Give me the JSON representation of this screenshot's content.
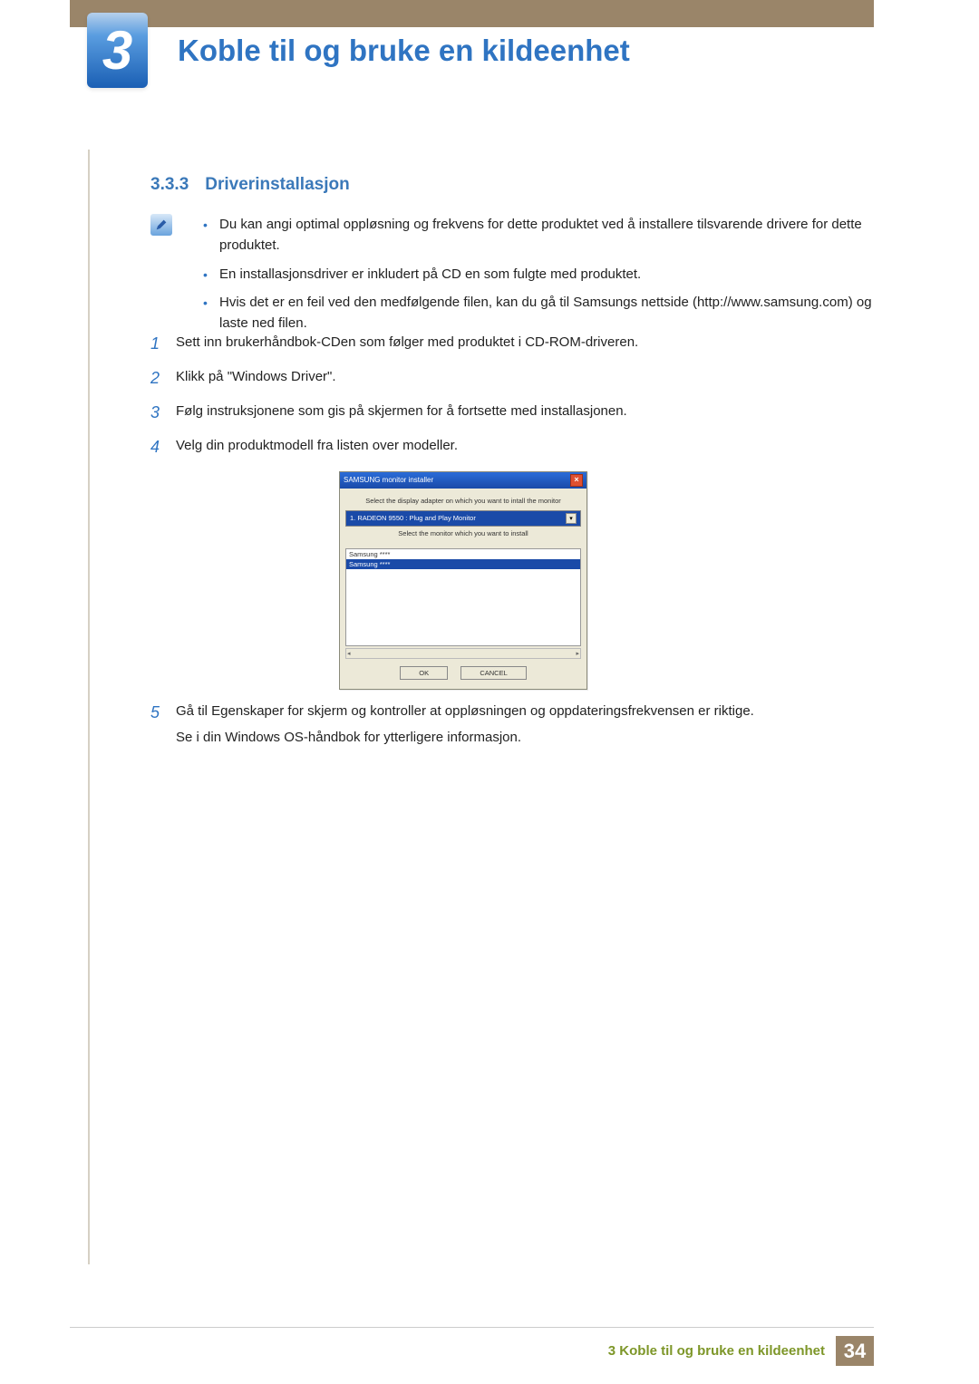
{
  "chapter": {
    "number": "3",
    "title": "Koble til og bruke en kildeenhet"
  },
  "section": {
    "number": "3.3.3",
    "title": "Driverinstallasjon"
  },
  "info_bullets": [
    "Du kan angi optimal oppløsning og frekvens for dette produktet ved å installere tilsvarende drivere for dette produktet.",
    "En installasjonsdriver er inkludert på CD en som fulgte med produktet.",
    "Hvis det er en feil ved den medfølgende filen, kan du gå til Samsungs nettside (http://www.samsung.com) og laste ned filen."
  ],
  "steps": {
    "s1": "Sett inn brukerhåndbok-CDen som følger med produktet i CD-ROM-driveren.",
    "s2": "Klikk på \"Windows Driver\".",
    "s3": "Følg instruksjonene som gis på skjermen for å fortsette med installasjonen.",
    "s4": "Velg din produktmodell fra listen over modeller.",
    "s5a": "Gå til Egenskaper for skjerm og kontroller at oppløsningen og oppdateringsfrekvensen er riktige.",
    "s5b": "Se i din Windows OS-håndbok for ytterligere informasjon."
  },
  "installer": {
    "title": "SAMSUNG monitor installer",
    "label1": "Select the display adapter on which you want to intall the monitor",
    "adapter": "1. RADEON 9550 : Plug and Play Monitor",
    "label2": "Select the monitor which you want to install",
    "item1": "Samsung ****",
    "item2": "Samsung ****",
    "ok": "OK",
    "cancel": "CANCEL"
  },
  "footer": {
    "text": "3 Koble til og bruke en kildeenhet",
    "page": "34"
  }
}
